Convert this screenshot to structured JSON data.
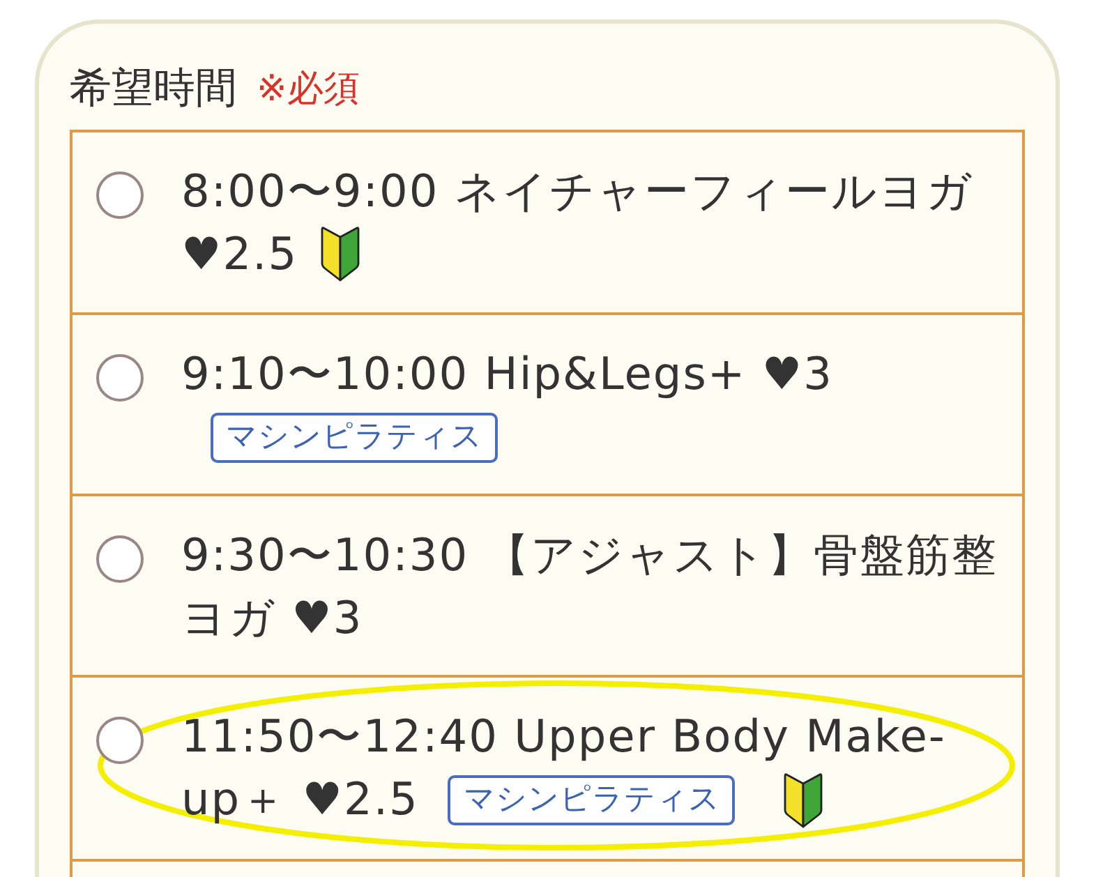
{
  "field": {
    "label": "希望時間",
    "required_note": "※必須"
  },
  "options": [
    {
      "label": "8:00〜9:00 ネイチャーフィールヨガ ♥2.5",
      "beginner_mark": true,
      "selected": false,
      "highlighted": false
    },
    {
      "label": "9:10〜10:00 Hip&Legs+ ♥3",
      "tags": [
        "マシンピラティス"
      ],
      "beginner_mark": false,
      "selected": false,
      "highlighted": false
    },
    {
      "label": "9:30〜10:30 【アジャスト】骨盤筋整ヨガ ♥3",
      "beginner_mark": false,
      "selected": false,
      "highlighted": false
    },
    {
      "label": "11:50〜12:40 Upper Body Make-up＋ ♥2.5",
      "tags": [
        "マシンピラティス"
      ],
      "beginner_mark": true,
      "selected": false,
      "highlighted": true
    }
  ]
}
